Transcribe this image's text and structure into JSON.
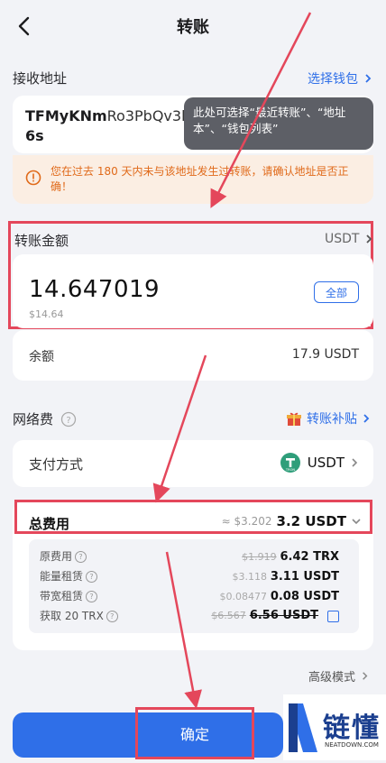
{
  "header": {
    "title": "转账"
  },
  "receive": {
    "label": "接收地址",
    "select_wallet": "选择钱包",
    "address_bold": "TFMyKNm",
    "address_rest": "Ro3PbQv3k",
    "address_line2": "6s",
    "tooltip": "此处可选择“最近转账”、“地址本”、“钱包列表”"
  },
  "warning": {
    "text": "您在过去 180 天内未与该地址发生过转账，请确认地址是否正确！"
  },
  "amount": {
    "label": "转账金额",
    "token": "USDT",
    "value": "14.647019",
    "fiat": "$14.64",
    "all_button": "全部"
  },
  "balance": {
    "label": "余额",
    "value": "17.9 USDT"
  },
  "network": {
    "label": "网络费",
    "subsidy": "转账补贴"
  },
  "payment": {
    "label": "支付方式",
    "token": "USDT",
    "token_icon_text": "TRON"
  },
  "fee": {
    "label": "总费用",
    "approx": "≈ $3.202",
    "total": "3.2 USDT",
    "rows": [
      {
        "label": "原费用",
        "gray": "$1.919",
        "value": "6.42 TRX"
      },
      {
        "label": "能量租赁",
        "gray": "$3.118",
        "value": "3.11 USDT"
      },
      {
        "label": "带宽租赁",
        "gray": "$0.08477",
        "value": "0.08 USDT"
      },
      {
        "label": "获取 20 TRX",
        "gray": "$6.567",
        "value": "6.56 USDT"
      }
    ]
  },
  "advanced": "高级模式",
  "confirm": "确定",
  "watermark": {
    "title": "链懂",
    "site": "NEATDOWN.COM"
  },
  "colors": {
    "accent": "#2f6fe8",
    "warning": "#e06a1a",
    "highlight": "#e4475b"
  }
}
